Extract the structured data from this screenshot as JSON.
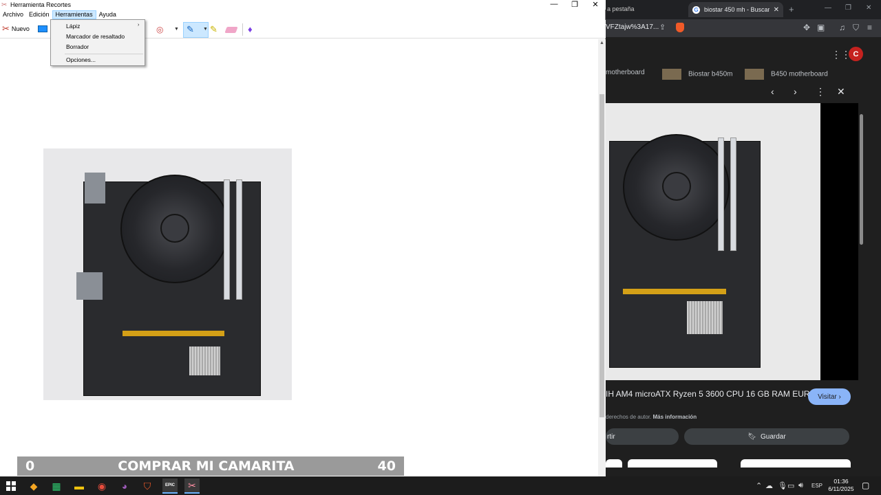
{
  "snipping_tool": {
    "title": "Herramienta Recortes",
    "menu": [
      "Archivo",
      "Edición",
      "Herramientas",
      "Ayuda"
    ],
    "active_menu": "Herramientas",
    "toolbar": {
      "new_label": "Nuevo"
    },
    "dropdown": {
      "items": [
        "Lápiz",
        "Marcador de resaltado",
        "Borrador",
        "Opciones..."
      ]
    }
  },
  "overlay": {
    "left_number": "0",
    "text": "COMPRAR MI CAMARITA",
    "right_number": "40"
  },
  "browser": {
    "prev_tab_fragment": "a pestaña",
    "active_tab_title": "biostar 450 mh - Buscar c",
    "url_fragment": "VFZtajw%3A17...",
    "avatar_letter": "C",
    "chips": [
      "motherboard",
      "Biostar b450m",
      "B450 motherboard"
    ],
    "result_title": "IH AM4 microATX Ryzen 5 3600 CPU 16 GB RAM EUR",
    "visit_label": "Visitar",
    "copyright_text": "derechos de autor.",
    "copyright_link": "Más información",
    "share_fragment": "rtir",
    "save_label": "Guardar"
  },
  "taskbar": {
    "language": "ESP",
    "time": "01:36",
    "date": "6/11/2025",
    "epic_label": "EPIC"
  },
  "colors": {
    "chrome_bg": "#1f1f1f",
    "visit_button": "#8ab4f8",
    "menu_highlight": "#cce8ff",
    "banner_bg": "#9a9a9a",
    "pcie_slot": "#d4a017"
  }
}
